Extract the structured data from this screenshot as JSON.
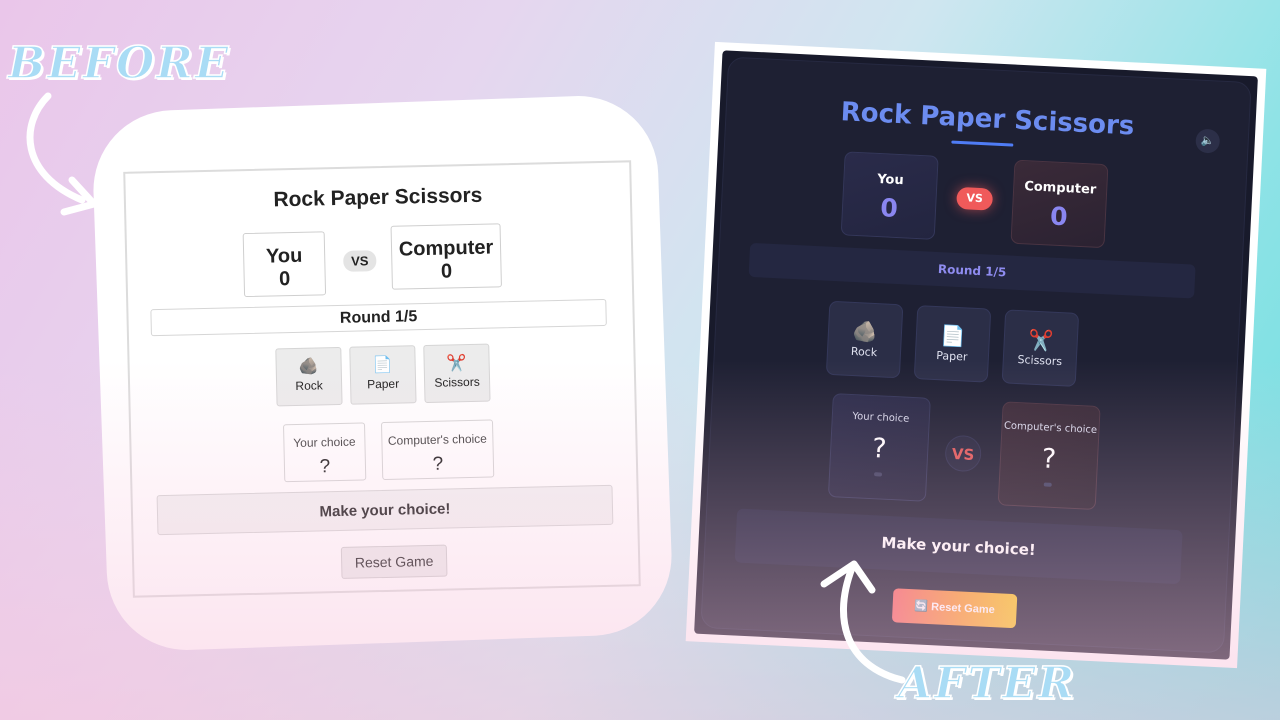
{
  "labels": {
    "before": "BEFORE",
    "after": "AFTER"
  },
  "before": {
    "title": "Rock Paper Scissors",
    "player": {
      "label": "You",
      "score": "0"
    },
    "computer": {
      "label": "Computer",
      "score": "0"
    },
    "vs": "VS",
    "round": "Round 1/5",
    "choices": [
      {
        "icon": "rock-icon",
        "glyph": "🪨",
        "label": "Rock"
      },
      {
        "icon": "paper-icon",
        "glyph": "📄",
        "label": "Paper"
      },
      {
        "icon": "scissors-icon",
        "glyph": "✂️",
        "label": "Scissors"
      }
    ],
    "your_choice": {
      "label": "Your choice",
      "value": "?"
    },
    "computer_choice": {
      "label": "Computer's choice",
      "value": "?"
    },
    "message": "Make your choice!",
    "reset": "Reset Game"
  },
  "after": {
    "title": "Rock Paper Scissors",
    "sound_icon": "speaker-icon",
    "player": {
      "label": "You",
      "score": "0"
    },
    "computer": {
      "label": "Computer",
      "score": "0"
    },
    "vs": "VS",
    "round": "Round 1/5",
    "choices": [
      {
        "icon": "rock-icon",
        "glyph": "🪨",
        "label": "Rock"
      },
      {
        "icon": "paper-icon",
        "glyph": "📄",
        "label": "Paper"
      },
      {
        "icon": "scissors-icon",
        "glyph": "✂️",
        "label": "Scissors"
      }
    ],
    "your_choice": {
      "label": "Your choice",
      "value": "?"
    },
    "computer_choice": {
      "label": "Computer's choice",
      "value": "?"
    },
    "vs_middle": "VS",
    "message": "Make your choice!",
    "reset": "Reset Game",
    "reset_icon": "refresh-icon",
    "colors": {
      "accent": "#6c8cf0",
      "vs": "#f05a5a",
      "panel": "#1e2033"
    }
  }
}
